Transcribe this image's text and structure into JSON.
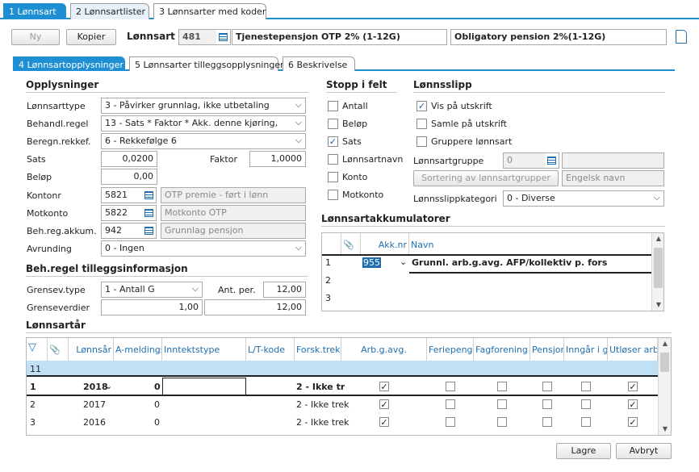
{
  "top_tabs": [
    {
      "num": "1",
      "label": "Lønnsart"
    },
    {
      "num": "2",
      "label": "Lønnsartlister"
    },
    {
      "num": "3",
      "label": "Lønnsarter med koder"
    }
  ],
  "toolbar": {
    "new_label": "Ny",
    "copy_label": "Kopier",
    "field_label": "Lønnsart",
    "id": "481",
    "name": "Tjenestepensjon OTP 2% (1-12G)",
    "name_en": "Obligatory pension 2%(1-12G)"
  },
  "sub_tabs": [
    {
      "num": "4",
      "label": "Lønnsartopplysninger"
    },
    {
      "num": "5",
      "label": "Lønnsarter tilleggsopplysninger"
    },
    {
      "num": "6",
      "label": "Beskrivelse"
    }
  ],
  "opplysninger": {
    "header": "Opplysninger",
    "lonnsarttype_label": "Lønnsarttype",
    "lonnsarttype": "3 - Påvirker grunnlag, ikke utbetaling",
    "behandl_label": "Behandl.regel",
    "behandl": "13 - Sats * Faktor * Akk. denne kjøring,",
    "beregn_label": "Beregn.rekkef.",
    "beregn": "6 - Rekkefølge 6",
    "sats_label": "Sats",
    "sats": "0,0200",
    "faktor_label": "Faktor",
    "faktor": "1,0000",
    "belop_label": "Beløp",
    "belop": "0,00",
    "kontonr_label": "Kontonr",
    "kontonr": "5821",
    "kontonr_desc": "OTP premie - ført i lønn",
    "motkonto_label": "Motkonto",
    "motkonto": "5822",
    "motkonto_desc": "Motkonto OTP",
    "behreg_label": "Beh.reg.akkum.",
    "behreg": "942",
    "behreg_desc": "Grunnlag pensjon",
    "avrunding_label": "Avrunding",
    "avrunding": "0 - Ingen"
  },
  "tillegg": {
    "header": "Beh.regel tilleggsinformasjon",
    "grensev_label": "Grensev.type",
    "grensev": "1 - Antall G",
    "antper_label": "Ant. per.",
    "antper": "12,00",
    "grenseverdier_label": "Grenseverdier",
    "grense1": "1,00",
    "grense2": "12,00"
  },
  "stopp": {
    "header": "Stopp i felt",
    "items": [
      {
        "label": "Antall",
        "checked": false
      },
      {
        "label": "Beløp",
        "checked": false
      },
      {
        "label": "Sats",
        "checked": true
      },
      {
        "label": "Lønnsartnavn",
        "checked": false
      },
      {
        "label": "Konto",
        "checked": false
      },
      {
        "label": "Motkonto",
        "checked": false
      }
    ]
  },
  "lonnsslipp": {
    "header": "Lønnsslipp",
    "vis": "Vis på utskrift",
    "samle": "Samle på utskrift",
    "gruppere": "Gruppere lønnsart",
    "gruppe_label": "Lønnsartgruppe",
    "gruppe": "0",
    "sort_btn": "Sortering av lønnsartgrupper",
    "eng_placeholder": "Engelsk navn",
    "kategori_label": "Lønnsslippkategori",
    "kategori": "0 - Diverse"
  },
  "akkumulatorer": {
    "header": "Lønnsartakkumulatorer",
    "col_akk": "Akk.nr",
    "col_navn": "Navn",
    "rows": [
      {
        "num": "1",
        "akk": "955",
        "navn": "Grunnl. arb.g.avg. AFP/kollektiv p. fors"
      },
      {
        "num": "2",
        "akk": "",
        "navn": ""
      },
      {
        "num": "3",
        "akk": "",
        "navn": ""
      }
    ]
  },
  "lonnsartar": {
    "header": "Lønnsartår",
    "columns": [
      "Lønnsår",
      "A-meldings",
      "Inntektstype",
      "L/T-kode",
      "Forsk.trekk",
      "Arb.g.avg.",
      "Feriepenge",
      "Fagforening",
      "Pensjon",
      "Inngår i gr",
      "Utløser arb."
    ],
    "count": "11",
    "rows": [
      {
        "num": "1",
        "year": "2018",
        "a": "0",
        "forsk": "2 - Ikke tr",
        "checks": [
          true,
          false,
          false,
          false,
          false,
          true
        ]
      },
      {
        "num": "2",
        "year": "2017",
        "a": "0",
        "forsk": "2 - Ikke trek",
        "checks": [
          true,
          false,
          false,
          false,
          false,
          true
        ]
      },
      {
        "num": "3",
        "year": "2016",
        "a": "0",
        "forsk": "2 - Ikke trek",
        "checks": [
          true,
          false,
          false,
          false,
          false,
          true
        ]
      }
    ]
  },
  "footer": {
    "save": "Lagre",
    "cancel": "Avbryt"
  }
}
